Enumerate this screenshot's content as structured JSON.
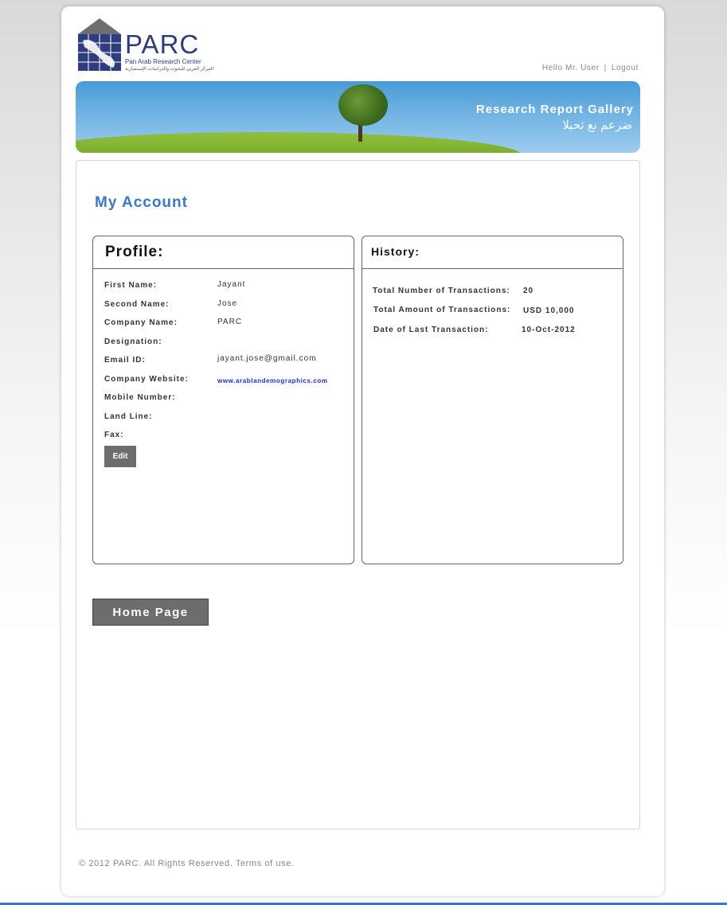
{
  "header": {
    "logo_title": "PARC",
    "logo_subtitle": "Pan Arab Research Center",
    "logo_arabic": "المركز العربي للبحوث والدراسات الإستشارية",
    "greeting": "Hello Mr. User",
    "separator": "|",
    "logout_label": "Logout"
  },
  "banner": {
    "title": "Research Report Gallery",
    "arabic_title": "ضرعم نع ثحبلا"
  },
  "main": {
    "page_title": "My Account",
    "profile": {
      "heading": "Profile:",
      "fields": [
        {
          "label": "First Name:",
          "value": "Jayant"
        },
        {
          "label": "Second Name:",
          "value": "Jose"
        },
        {
          "label": "Company Name:",
          "value": "PARC"
        },
        {
          "label": "Designation:",
          "value": ""
        },
        {
          "label": "Email ID:",
          "value": "jayant.jose@gmail.com"
        },
        {
          "label": "Company Website:",
          "value": "www.arablandemographics.com"
        },
        {
          "label": "Mobile Number:",
          "value": ""
        },
        {
          "label": "Land Line:",
          "value": ""
        },
        {
          "label": "Fax:",
          "value": ""
        }
      ],
      "edit_label": "Edit"
    },
    "history": {
      "heading": "History:",
      "rows": [
        {
          "label": "Total Number of Transactions:",
          "value": "20"
        },
        {
          "label": "Total Amount of Transactions:",
          "value": "USD 10,000"
        },
        {
          "label": "Date of Last Transaction:",
          "value": "10-Oct-2012"
        }
      ]
    },
    "home_button_label": "Home Page"
  },
  "footer": {
    "copyright": "© 2012 PARC. All Rights Reserved. Terms of use."
  },
  "colors": {
    "accent_blue": "#3a78c4",
    "button_gray": "#6d6d6d",
    "logo_navy": "#2f3d7e",
    "link_blue": "#1a2bd6"
  },
  "icons": {
    "logo": "parc-map-logo-icon"
  }
}
